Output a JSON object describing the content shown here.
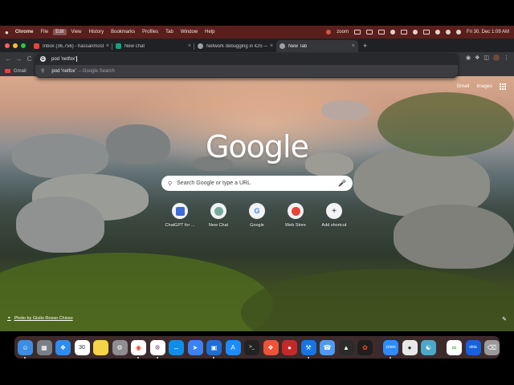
{
  "menubar": {
    "apple": "",
    "items": [
      "Chrome",
      "File",
      "Edit",
      "View",
      "History",
      "Bookmarks",
      "Profiles",
      "Tab",
      "Window",
      "Help"
    ],
    "zoom_label": "zoom",
    "datetime": "Fri 30. Dec  1:09 AM"
  },
  "tabs": [
    {
      "title": "Inbox (36,756) - hassanmostaf...",
      "favicon_color": "#ea4335",
      "close": "×"
    },
    {
      "title": "New chat",
      "favicon_color": "#10a37f",
      "close": "×"
    },
    {
      "title": "Network debugging in iOS — n...",
      "favicon_color": "#9aa0a6",
      "close": "×"
    },
    {
      "title": "New Tab",
      "favicon_color": "#9aa0a6",
      "close": "×"
    }
  ],
  "new_tab_label": "+",
  "toolbar": {
    "back": "←",
    "forward": "→",
    "reload": "C"
  },
  "omnibox": {
    "query": "pod 'netfox'",
    "suggestion": "pod 'netfox'",
    "suggestion_hint": "– Google Search"
  },
  "bookmarks": [
    {
      "label": "Gmail"
    }
  ],
  "page_links": {
    "gmail": "Gmail",
    "images": "Images"
  },
  "logo": "Google",
  "search": {
    "placeholder": "Search Google or type a URL"
  },
  "shortcuts": [
    {
      "label": "ChatGPT for ...",
      "icon": "chatgpt-icon",
      "color": "#10a37f"
    },
    {
      "label": "New Chat",
      "icon": "new-chat-icon",
      "color": "#74aa9c"
    },
    {
      "label": "Google",
      "icon": "google-icon",
      "color": "#4285f4"
    },
    {
      "label": "Web Store",
      "icon": "web-store-icon",
      "color": "#ea4335"
    },
    {
      "label": "Add shortcut",
      "icon": "plus-icon",
      "color": "#202124"
    }
  ],
  "photo_credit": "Photo by Giulio Rosso Chioso",
  "dock": {
    "calendar_day": "30",
    "apps": [
      {
        "name": "finder",
        "color": "#3a8ee6"
      },
      {
        "name": "launchpad",
        "color": "#7a7f87"
      },
      {
        "name": "safari",
        "color": "#2d8cf0"
      },
      {
        "name": "calendar",
        "color": "#ffffff"
      },
      {
        "name": "notes",
        "color": "#f5d547"
      },
      {
        "name": "system-settings",
        "color": "#8e8e93"
      },
      {
        "name": "chrome",
        "color": "#ffffff"
      },
      {
        "name": "slack",
        "color": "#ffffff"
      },
      {
        "name": "teamviewer",
        "color": "#0e8ee9"
      },
      {
        "name": "maps",
        "color": "#3b82f6"
      },
      {
        "name": "xcode-helper",
        "color": "#1c6fd6"
      },
      {
        "name": "app-store",
        "color": "#1a8cff"
      },
      {
        "name": "terminal",
        "color": "#222222"
      },
      {
        "name": "swift",
        "color": "#f05138"
      },
      {
        "name": "record",
        "color": "#c62828"
      },
      {
        "name": "xcode",
        "color": "#1575e6"
      },
      {
        "name": "simulator",
        "color": "#4b9cf5"
      },
      {
        "name": "instruments",
        "color": "#2b2b2b"
      },
      {
        "name": "figma",
        "color": "#1e1e1e"
      },
      {
        "name": "zoom",
        "color": "#2d8cff"
      },
      {
        "name": "proxyman",
        "color": "#e8e8e8"
      },
      {
        "name": "paw",
        "color": "#4aa8c8"
      },
      {
        "name": "upwork",
        "color": "#ffffff"
      },
      {
        "name": "okta",
        "color": "#1662dd"
      },
      {
        "name": "trash",
        "color": "#9a9a9a"
      }
    ]
  }
}
